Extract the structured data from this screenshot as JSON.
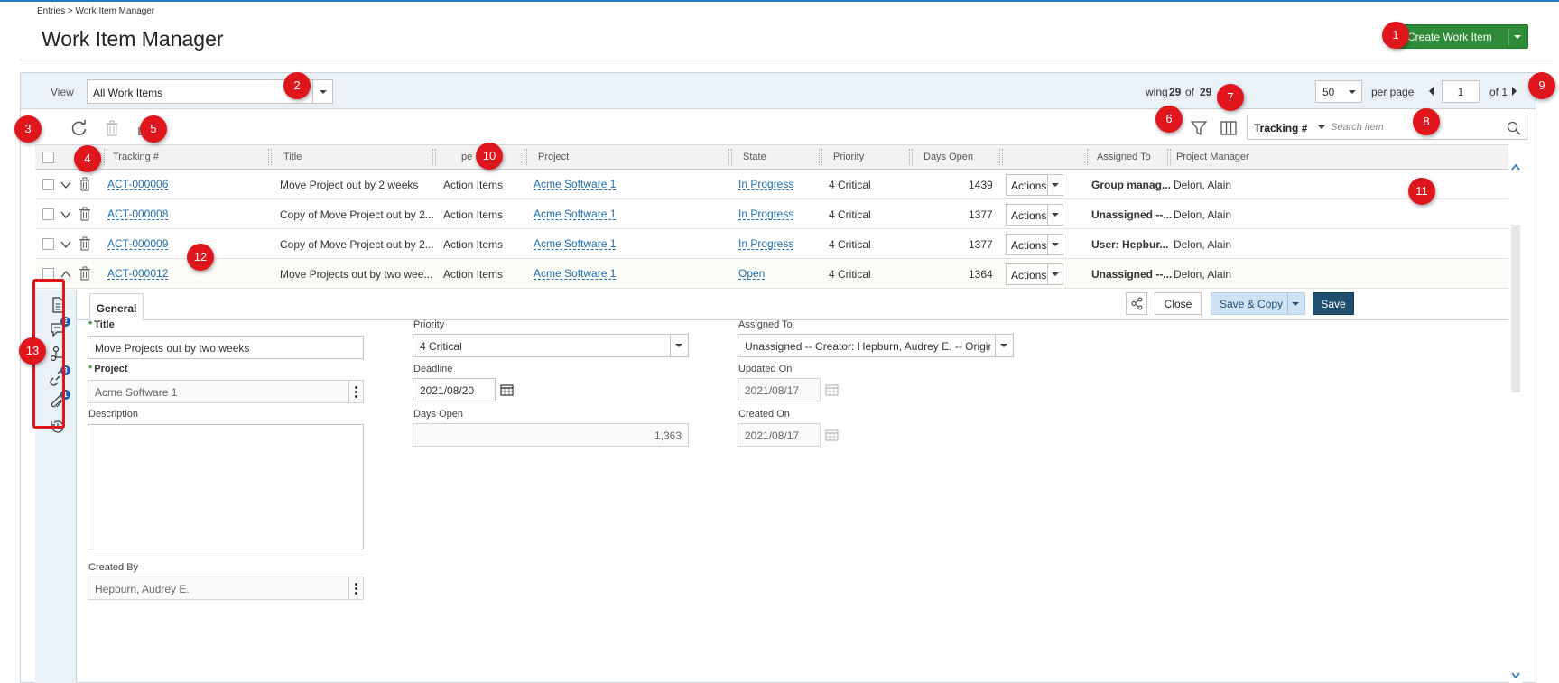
{
  "breadcrumb": "Entries > Work Item Manager",
  "page_title": "Work Item Manager",
  "create_button": {
    "label": "Create Work Item"
  },
  "viewbar": {
    "view_label": "View",
    "view_value": "All Work Items",
    "showing_prefix": "wing",
    "showing_count": "29",
    "showing_of": "of",
    "showing_total": "29",
    "per_page_value": "50",
    "per_page_label": "per page",
    "page_value": "1",
    "page_of": "of 1"
  },
  "search": {
    "field": "Tracking #",
    "placeholder": "Search item"
  },
  "columns": [
    "Tracking #",
    "Title",
    "pe",
    "Project",
    "State",
    "Priority",
    "Days Open",
    "",
    "Assigned To",
    "Project Manager"
  ],
  "rows": [
    {
      "tracking": "ACT-000006",
      "title": "Move Project out by 2 weeks",
      "type": "Action Items",
      "project": "Acme Software 1",
      "state": "In Progress",
      "priority": "4 Critical",
      "days_open": "1439",
      "actions": "Actions",
      "assigned_to": "Group manag...",
      "project_manager": "Delon, Alain"
    },
    {
      "tracking": "ACT-000008",
      "title": "Copy of Move Project out by 2...",
      "type": "Action Items",
      "project": "Acme Software 1",
      "state": "In Progress",
      "priority": "4 Critical",
      "days_open": "1377",
      "actions": "Actions",
      "assigned_to": "Unassigned --...",
      "project_manager": "Delon, Alain"
    },
    {
      "tracking": "ACT-000009",
      "title": "Copy of Move Project out by 2...",
      "type": "Action Items",
      "project": "Acme Software 1",
      "state": "In Progress",
      "priority": "4 Critical",
      "days_open": "1377",
      "actions": "Actions",
      "assigned_to": "User: Hepbur...",
      "project_manager": "Delon, Alain"
    },
    {
      "tracking": "ACT-000012",
      "title": "Move Projects out by two wee...",
      "type": "Action Items",
      "project": "Acme Software 1",
      "state": "Open",
      "priority": "4 Critical",
      "days_open": "1364",
      "actions": "Actions",
      "assigned_to": "Unassigned --...",
      "project_manager": "Delon, Alain"
    }
  ],
  "detail": {
    "tab_label": "General",
    "close_label": "Close",
    "save_copy_label": "Save & Copy",
    "save_label": "Save",
    "rail_badges": {
      "comments": "2",
      "links": "3",
      "attachments": "1"
    },
    "fields": {
      "title_label": "Title",
      "title_value": "Move Projects out by two weeks",
      "project_label": "Project",
      "project_value": "Acme Software 1",
      "description_label": "Description",
      "created_by_label": "Created By",
      "created_by_value": "Hepburn, Audrey E.",
      "priority_label": "Priority",
      "priority_value": "4 Critical",
      "deadline_label": "Deadline",
      "deadline_value": "2021/08/20",
      "days_open_label": "Days Open",
      "days_open_value": "1,363",
      "assigned_to_label": "Assigned To",
      "assigned_to_value": "Unassigned -- Creator: Hepburn, Audrey E. -- Originat...",
      "updated_on_label": "Updated On",
      "updated_on_value": "2021/08/17",
      "created_on_label": "Created On",
      "created_on_value": "2021/08/17"
    }
  },
  "markers": [
    "1",
    "2",
    "3",
    "4",
    "5",
    "6",
    "7",
    "8",
    "9",
    "10",
    "11",
    "12",
    "13"
  ],
  "colors": {
    "primary_green": "#2e8b3a",
    "link_blue": "#1f6fb2",
    "marker_red": "#e0161d",
    "save_dark": "#1e4f6e"
  }
}
